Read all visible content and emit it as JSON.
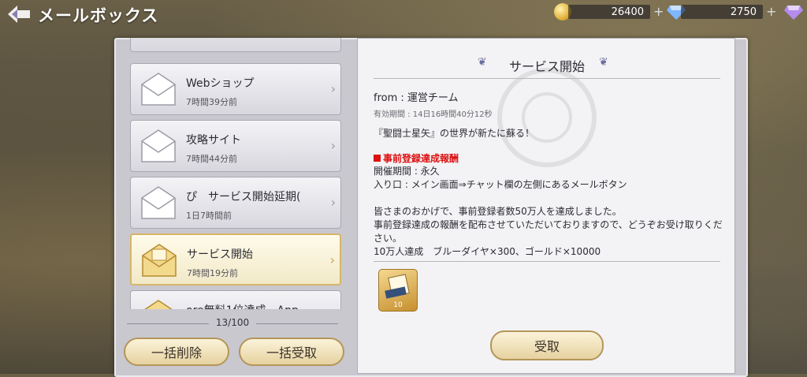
{
  "header": {
    "title": "メールボックス"
  },
  "currency": [
    {
      "icon": "gold-coin-icon",
      "value": "26400"
    },
    {
      "icon": "blue-diamond-icon",
      "value": "2750"
    }
  ],
  "mail_list": {
    "items": [
      {
        "title": "",
        "time": "",
        "state": "partial-top"
      },
      {
        "title": "Webショップ",
        "time": "7時間39分前"
      },
      {
        "title": "攻略サイト",
        "time": "7時間44分前"
      },
      {
        "title": "ぴ　サービス開始延期(",
        "time": "1日7時間前"
      },
      {
        "title": "サービス開始",
        "time": "7時間19分前",
        "active": true
      },
      {
        "title": "ore無料1位達成　App",
        "time": "",
        "state": "partial-bottom"
      }
    ],
    "count": "13/100"
  },
  "buttons": {
    "delete_all": "一括削除",
    "claim_all": "一括受取",
    "claim": "受取"
  },
  "detail": {
    "title": "サービス開始",
    "from": "from : 運営チーム",
    "expire": "有効期間 : 14日16時間40分12秒",
    "intro": "『聖闘士星矢』の世界が新たに蘇る！",
    "section_title": "事前登録達成報酬",
    "section_body": "開催期間 : 永久\n入り口 : メイン画面⇒チャット欄の左側にあるメールボタン",
    "paragraph": "皆さまのおかげで、事前登録者数50万人を達成しました。\n事前登録達成の報酬を配布させていただいておりますので、どうぞお受け取りください。\n10万人達成　ブルーダイヤ×300、ゴールド×10000",
    "attachment_qty": "10"
  },
  "colors": {
    "accent_gold": "#d6b56a",
    "alert_red": "#dd1111"
  }
}
